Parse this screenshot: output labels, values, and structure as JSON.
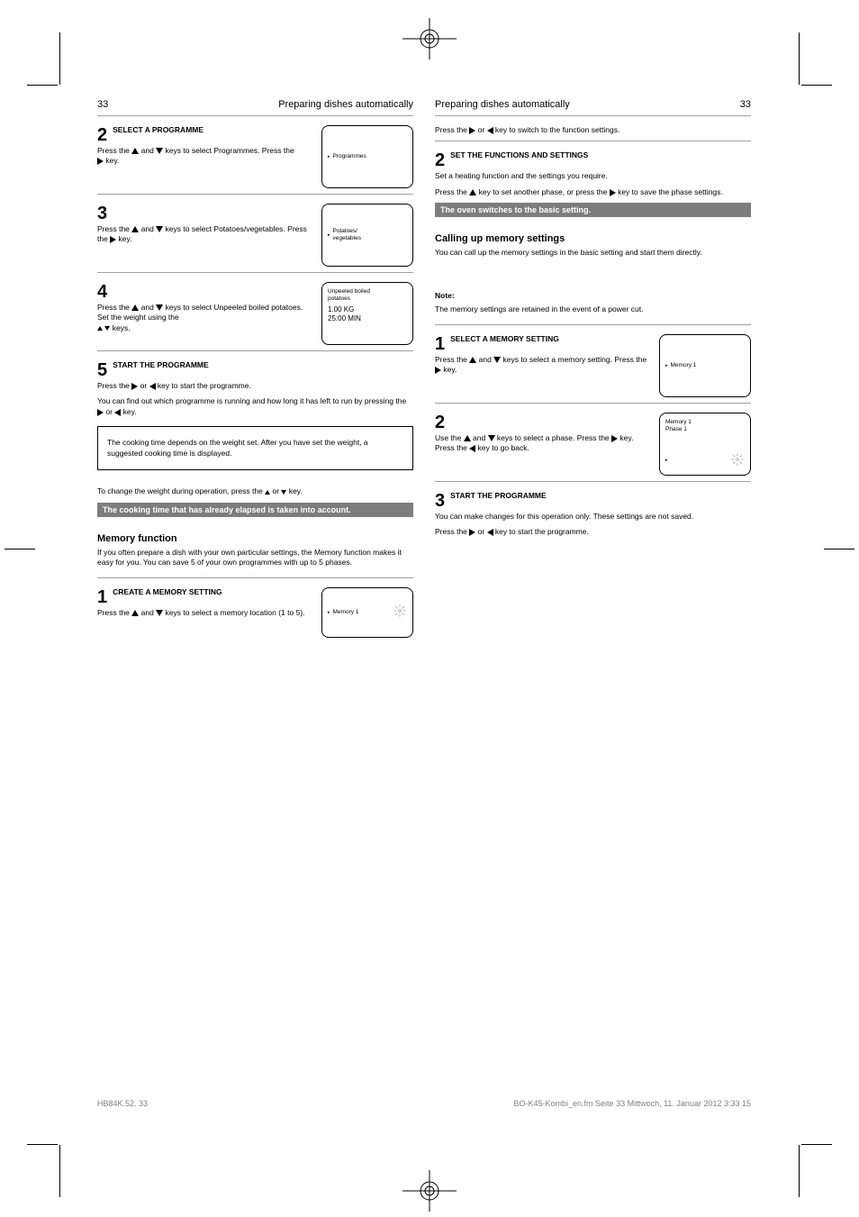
{
  "glyphs": {
    "pointer": "▸"
  },
  "left": {
    "pagetab": "33",
    "header": "Preparing dishes automatically",
    "step2": {
      "num": "2",
      "label": "Select a programme",
      "text_a": "Press the ",
      "text_b": " and ",
      "text_c": " keys to select Programmes. Press the ",
      "text_d": " key.",
      "screen": {
        "line1": "Programmes",
        "line2": ""
      }
    },
    "step3": {
      "num": "3",
      "text_a": "Press the ",
      "text_b": " and ",
      "text_c": " keys to select Potatoes/vegetables. Press the ",
      "text_d": " key.",
      "screen": {
        "line1": "Potatoes/",
        "line2": "vegetables"
      }
    },
    "step4": {
      "num": "4",
      "text_a": "Press the ",
      "text_b": " and ",
      "text_c": " keys to select Unpeeled boiled potatoes. Set the weight using the ",
      "text_d": " keys.",
      "screen": {
        "line1": "Unpeeled boiled",
        "line2": "potatoes",
        "line3": "1.00  KG",
        "line4": "25:00  MIN"
      }
    },
    "step5": {
      "num": "5",
      "label": "Start the programme",
      "text_a": "Press the ",
      "text_b": " or ",
      "text_c": " key to start the programme.",
      "tail": "You can find out which programme is running and how long it has left to run by pressing the ",
      "tail_b": " or ",
      "tail_c": " key."
    },
    "box": "The cooking time depends on the weight set. After you have set the weight, a suggested cooking time is displayed.",
    "weightchange": {
      "title": "To change the weight during operation, press the ",
      "title_b": " or ",
      "title_c": " key.",
      "bar": "The cooking time that has already elapsed is taken into account."
    },
    "section": {
      "title": "Memory function",
      "desc": "If you often prepare a dish with your own particular settings, the Memory function makes it easy for you. You can save 5 of your own programmes with up to 5 phases."
    },
    "mem_step1": {
      "num": "1",
      "label": "Create a memory setting",
      "text_a": "Press the ",
      "text_b": " and ",
      "text_c": " keys to select a memory location (1 to 5).",
      "screen": {
        "line1": "Memory 1",
        "icon": true
      }
    }
  },
  "right": {
    "header": "Preparing dishes automatically",
    "pagetab": "33",
    "top": {
      "text_a": "Press the ",
      "text_b": " or ",
      "text_c": " key to switch to the function settings."
    },
    "step2": {
      "num": "2",
      "label": "Set the functions and settings",
      "text": "Set a heating function and the settings you require.",
      "tail_a": "Press the ",
      "tail_b": " key to set another phase, or press the ",
      "tail_c": " key to save the phase settings.",
      "bar": "The oven switches to the basic setting."
    },
    "calling": {
      "title": "Calling up memory settings",
      "desc": "You can call up the memory settings in the basic setting and start them directly.",
      "note_label": "Note:",
      "note": "The memory settings are retained in the event of a power cut."
    },
    "step1": {
      "num": "1",
      "label": "Select a memory setting",
      "text_a": "Press the ",
      "text_b": " and ",
      "text_c": " keys to select a memory setting. Press the ",
      "text_d": " key.",
      "screen": {
        "line1": "Memory 1"
      }
    },
    "stepA2": {
      "num": "2",
      "text_a": "Use the ",
      "text_b": " and ",
      "text_c": " keys to select a phase. Press the ",
      "text_d": " key. Press the ",
      "text_e": " key to go back.",
      "screen": {
        "line1": "Memory 1",
        "line2": "Phase 1",
        "icon": true
      }
    },
    "step3": {
      "num": "3",
      "label": "Start the programme",
      "text": "You can make changes for this operation only. These settings are not saved.",
      "tail_a": "Press the ",
      "tail_b": " or ",
      "tail_c": " key to start the programme."
    }
  },
  "footer_left": "HB84K.52. 33",
  "footer_right": "BO-K45-Kombi_en.fm  Seite 33  Mittwoch, 11. Januar 2012  3:33 15"
}
